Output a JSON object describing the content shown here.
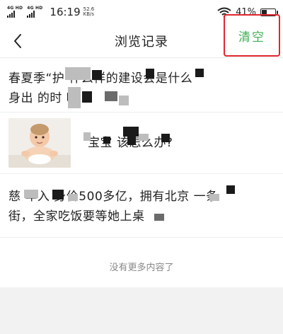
{
  "status_bar": {
    "network_1": "4G HD",
    "network_2": "4G HD",
    "time": "16:19",
    "speed_value": "52.6",
    "speed_unit": "KB/s",
    "battery": "41%",
    "battery_level": 0.41
  },
  "header": {
    "title": "浏览记录",
    "clear_label": "清空",
    "accent_color": "#3fae55",
    "highlight_color": "#e0262e"
  },
  "history": [
    {
      "line1": "春夏季“护                         什么样的建设会是什么",
      "line2": "身出             的时        哈"
    },
    {
      "text": "            宝宝            该怎么办?"
    },
    {
      "line1": "慈    年入    身价500多亿，拥有北京         一条",
      "line2": "街，全家吃饭要等她上桌"
    }
  ],
  "footer": {
    "no_more": "没有更多内容了"
  }
}
